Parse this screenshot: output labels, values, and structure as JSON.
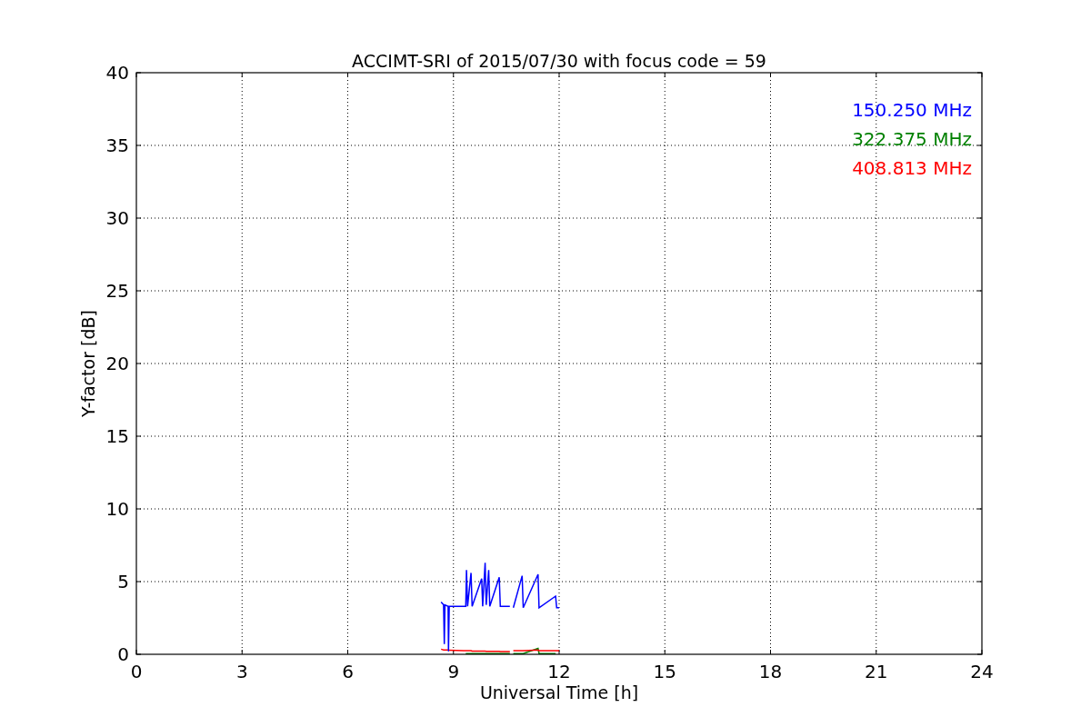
{
  "chart": {
    "chart_data": {
      "type": "line",
      "title": "ACCIMT-SRI of 2015/07/30 with focus code = 59",
      "xlabel": "Universal Time [h]",
      "ylabel": "Y-factor [dB]",
      "x": [
        8.65,
        8.72,
        8.74,
        8.76,
        8.85,
        8.86,
        8.88,
        9.35,
        9.37,
        9.4,
        9.5,
        9.53,
        9.8,
        9.83,
        9.9,
        9.93,
        10.0,
        10.03,
        10.3,
        10.33,
        10.6,
        10.65,
        10.7,
        10.95,
        10.98,
        11.4,
        11.43,
        11.9,
        11.93,
        12.0
      ],
      "series": [
        {
          "name": "150.250 MHz",
          "color": "#0000ff",
          "values": [
            3.6,
            3.4,
            0.7,
            3.4,
            3.3,
            0.2,
            3.3,
            3.3,
            5.8,
            3.3,
            5.6,
            3.3,
            5.2,
            3.3,
            6.3,
            3.4,
            5.8,
            3.3,
            5.3,
            3.3,
            3.3,
            null,
            3.2,
            5.4,
            3.2,
            5.5,
            3.2,
            4.0,
            3.2,
            3.2
          ]
        },
        {
          "name": "322.375 MHz",
          "color": "#008000",
          "values": [
            null,
            null,
            null,
            null,
            null,
            null,
            null,
            0.05,
            0.05,
            0.05,
            0.05,
            0.05,
            0.05,
            0.05,
            0.05,
            0.05,
            0.05,
            0.05,
            0.05,
            0.05,
            0.05,
            null,
            0.05,
            0.05,
            0.05,
            0.4,
            0.05,
            0.05,
            null,
            null
          ]
        },
        {
          "name": "408.813 MHz",
          "color": "#ff0000",
          "values": [
            0.35,
            0.3,
            0.3,
            0.3,
            0.3,
            0.28,
            0.28,
            0.25,
            0.25,
            0.25,
            0.25,
            0.22,
            0.22,
            0.22,
            0.22,
            0.2,
            0.2,
            0.2,
            0.2,
            0.18,
            0.18,
            null,
            0.25,
            0.25,
            0.25,
            0.3,
            0.25,
            0.25,
            0.25,
            0.25
          ]
        }
      ],
      "grid": true,
      "xlim": [
        0,
        24
      ],
      "ylim": [
        0,
        40
      ],
      "xticks": [
        0,
        3,
        6,
        9,
        12,
        15,
        18,
        21,
        24
      ],
      "yticks": [
        0,
        5,
        10,
        15,
        20,
        25,
        30,
        35,
        40
      ]
    }
  }
}
